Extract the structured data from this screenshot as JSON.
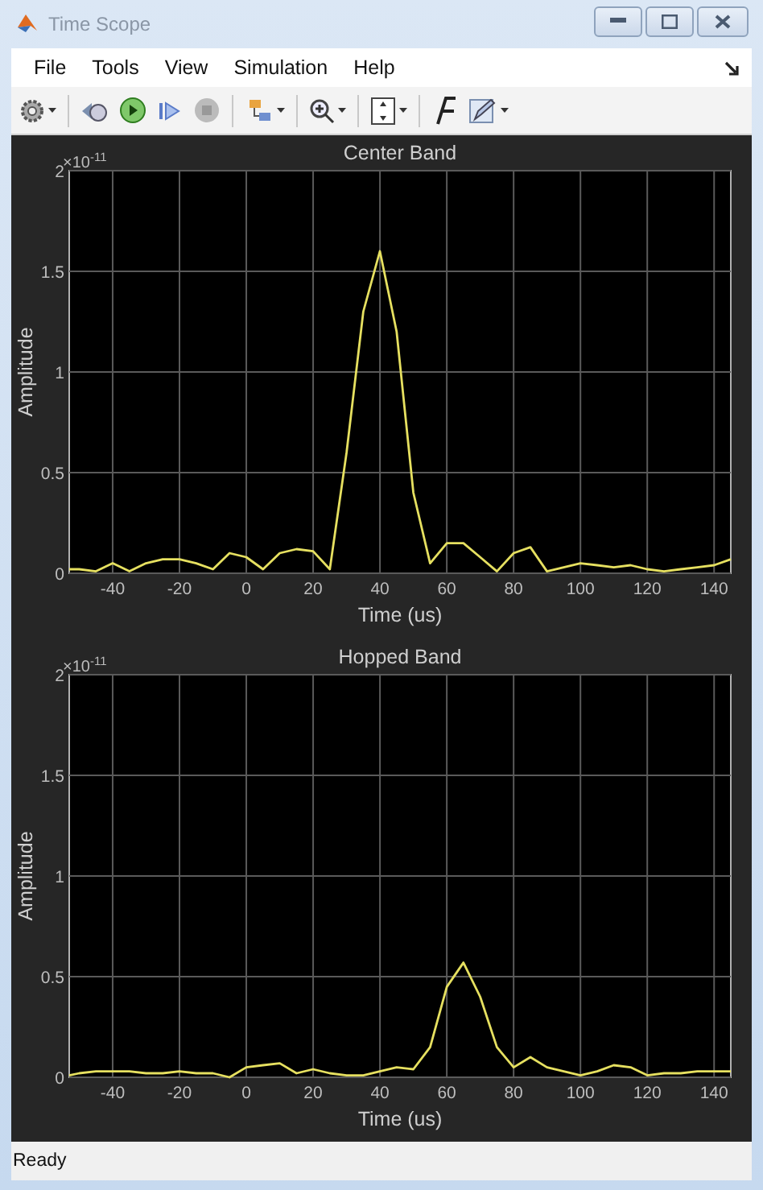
{
  "window": {
    "title": "Time Scope"
  },
  "menu": [
    {
      "label": "File"
    },
    {
      "label": "Tools"
    },
    {
      "label": "View"
    },
    {
      "label": "Simulation"
    },
    {
      "label": "Help"
    }
  ],
  "scopes": [
    {
      "scale_base": "×10",
      "scale_exponent": "-11",
      "chart_data": {
        "type": "line",
        "grid": true,
        "title": "Center Band",
        "xlabel": "Time (us)",
        "ylabel": "Amplitude",
        "x": [
          -53,
          -50,
          -45,
          -40,
          -35,
          -30,
          -25,
          -20,
          -15,
          -10,
          -5,
          0,
          5,
          10,
          15,
          20,
          25,
          30,
          35,
          40,
          45,
          50,
          55,
          60,
          65,
          70,
          75,
          80,
          85,
          90,
          95,
          100,
          105,
          110,
          115,
          120,
          125,
          130,
          135,
          140,
          145
        ],
        "xlim": [
          -53,
          145
        ],
        "ylim": [
          0,
          2
        ],
        "xticks": [
          -40,
          -20,
          0,
          20,
          40,
          60,
          80,
          100,
          120,
          140
        ],
        "yticks": [
          0,
          0.5,
          1,
          1.5,
          2
        ],
        "series": [
          {
            "color": "#e6e060",
            "values": [
              0.02,
              0.02,
              0.01,
              0.05,
              0.01,
              0.05,
              0.07,
              0.07,
              0.05,
              0.02,
              0.1,
              0.08,
              0.02,
              0.1,
              0.12,
              0.11,
              0.02,
              0.6,
              1.3,
              1.6,
              1.2,
              0.4,
              0.05,
              0.15,
              0.15,
              0.08,
              0.01,
              0.1,
              0.13,
              0.01,
              0.03,
              0.05,
              0.04,
              0.03,
              0.04,
              0.02,
              0.01,
              0.02,
              0.03,
              0.04,
              0.07
            ]
          }
        ]
      }
    },
    {
      "scale_base": "×10",
      "scale_exponent": "-11",
      "chart_data": {
        "type": "line",
        "grid": true,
        "title": "Hopped Band",
        "xlabel": "Time (us)",
        "ylabel": "Amplitude",
        "x": [
          -53,
          -50,
          -45,
          -40,
          -35,
          -30,
          -25,
          -20,
          -15,
          -10,
          -5,
          0,
          5,
          10,
          15,
          20,
          25,
          30,
          35,
          40,
          45,
          50,
          55,
          60,
          65,
          70,
          75,
          80,
          85,
          90,
          95,
          100,
          105,
          110,
          115,
          120,
          125,
          130,
          135,
          140,
          145
        ],
        "xlim": [
          -53,
          145
        ],
        "ylim": [
          0,
          2
        ],
        "xticks": [
          -40,
          -20,
          0,
          20,
          40,
          60,
          80,
          100,
          120,
          140
        ],
        "yticks": [
          0,
          0.5,
          1,
          1.5,
          2
        ],
        "series": [
          {
            "color": "#e6e060",
            "values": [
              0.01,
              0.02,
              0.03,
              0.03,
              0.03,
              0.02,
              0.02,
              0.03,
              0.02,
              0.02,
              0.0,
              0.05,
              0.06,
              0.07,
              0.02,
              0.04,
              0.02,
              0.01,
              0.01,
              0.03,
              0.05,
              0.04,
              0.15,
              0.45,
              0.57,
              0.4,
              0.15,
              0.05,
              0.1,
              0.05,
              0.03,
              0.01,
              0.03,
              0.06,
              0.05,
              0.01,
              0.02,
              0.02,
              0.03,
              0.03,
              0.03
            ]
          }
        ]
      }
    }
  ],
  "status_bar": {
    "text": "Ready"
  }
}
